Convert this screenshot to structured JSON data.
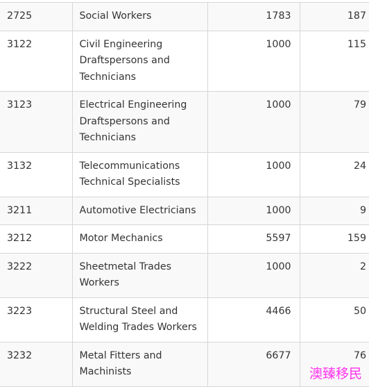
{
  "table": {
    "rows": [
      {
        "code": "2725",
        "occupation": "Social Workers",
        "ceiling": "1783",
        "invited": "187"
      },
      {
        "code": "3122",
        "occupation": "Civil Engineering Draftspersons and Technicians",
        "ceiling": "1000",
        "invited": "115"
      },
      {
        "code": "3123",
        "occupation": "Electrical Engineering Draftspersons and Technicians",
        "ceiling": "1000",
        "invited": "79"
      },
      {
        "code": "3132",
        "occupation": "Telecommunications Technical Specialists",
        "ceiling": "1000",
        "invited": "24"
      },
      {
        "code": "3211",
        "occupation": "Automotive Electricians",
        "ceiling": "1000",
        "invited": "9"
      },
      {
        "code": "3212",
        "occupation": "Motor Mechanics",
        "ceiling": "5597",
        "invited": "159"
      },
      {
        "code": "3222",
        "occupation": "Sheetmetal Trades Workers",
        "ceiling": "1000",
        "invited": "2"
      },
      {
        "code": "3223",
        "occupation": "Structural Steel and Welding Trades Workers",
        "ceiling": "4466",
        "invited": "50"
      },
      {
        "code": "3232",
        "occupation": "Metal Fitters and Machinists",
        "ceiling": "6677",
        "invited": "76"
      }
    ]
  },
  "watermark": {
    "text": "澳臻移民",
    "color": "#ff33ee"
  }
}
